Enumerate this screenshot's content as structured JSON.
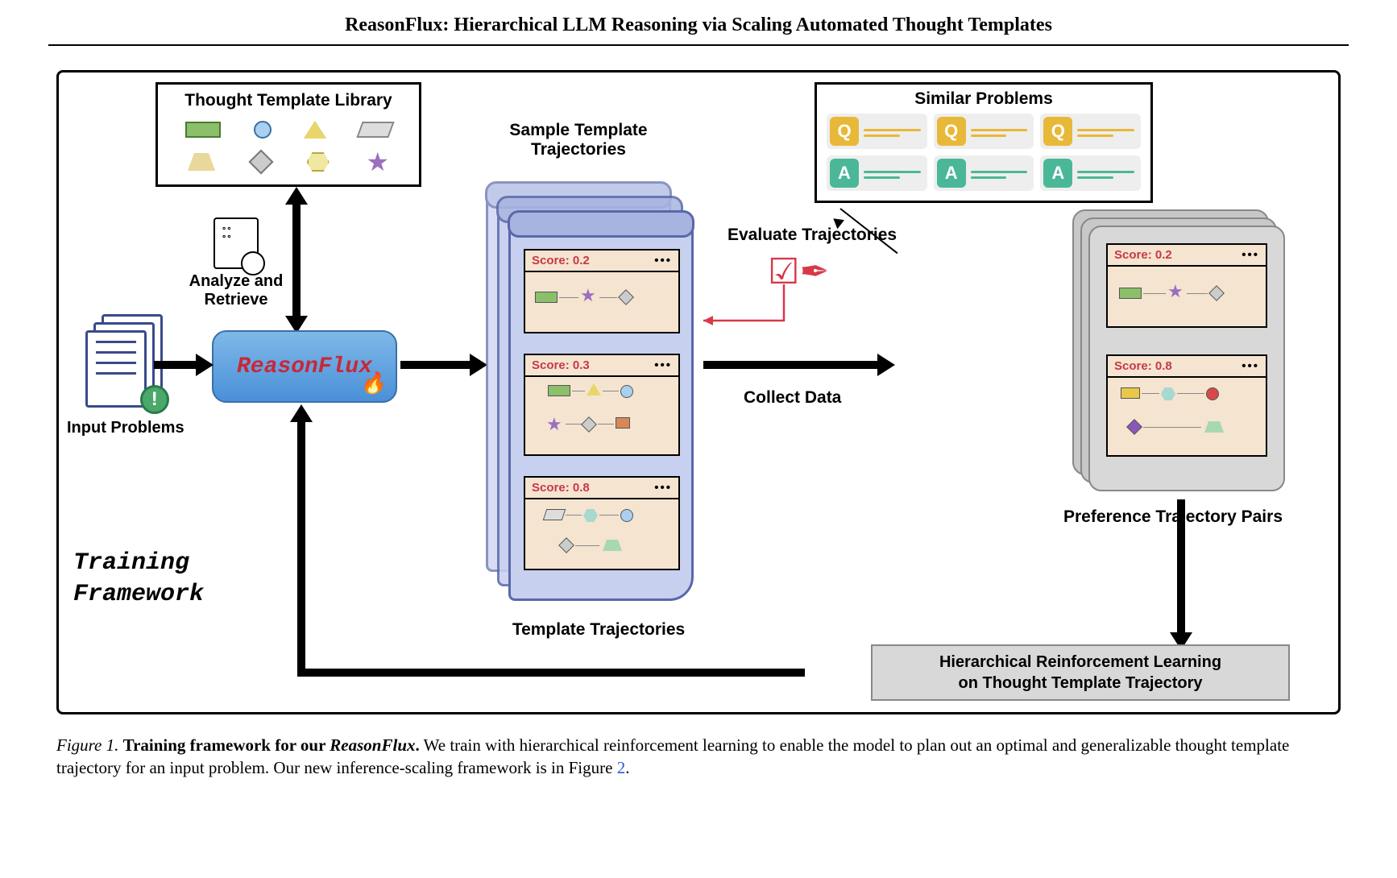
{
  "header": {
    "title": "ReasonFlux: Hierarchical LLM Reasoning via Scaling Automated Thought Templates"
  },
  "library": {
    "title": "Thought Template Library"
  },
  "analyze": {
    "label_line1": "Analyze and",
    "label_line2": "Retrieve"
  },
  "reasonflux": {
    "label": "ReasonFlux"
  },
  "input": {
    "label": "Input Problems"
  },
  "similar": {
    "title": "Similar Problems",
    "q_letter": "Q",
    "a_letter": "A"
  },
  "sample": {
    "label_line1": "Sample Template",
    "label_line2": "Trajectories"
  },
  "trajectories": {
    "cards": [
      {
        "score_label": "Score: 0.2"
      },
      {
        "score_label": "Score: 0.3"
      },
      {
        "score_label": "Score: 0.8"
      }
    ],
    "bottom_label": "Template Trajectories"
  },
  "eval": {
    "label": "Evaluate Trajectories"
  },
  "collect": {
    "label": "Collect Data"
  },
  "preference": {
    "cards": [
      {
        "score_label": "Score: 0.2"
      },
      {
        "score_label": "Score: 0.8"
      }
    ],
    "label": "Preference Trajectory Pairs"
  },
  "hrl": {
    "line1": "Hierarchical Reinforcement Learning",
    "line2": "on Thought Template Trajectory"
  },
  "training_framework": {
    "line1": "Training",
    "line2": "Framework"
  },
  "caption": {
    "fig_label": "Figure 1.",
    "bold": "Training framework for our",
    "name": "ReasonFlux",
    "period": ".",
    "body": " We train with hierarchical reinforcement learning to enable the model to plan out an optimal and generalizable thought template trajectory for an input problem. Our new inference-scaling framework is in Figure ",
    "ref": "2",
    "tail": "."
  }
}
